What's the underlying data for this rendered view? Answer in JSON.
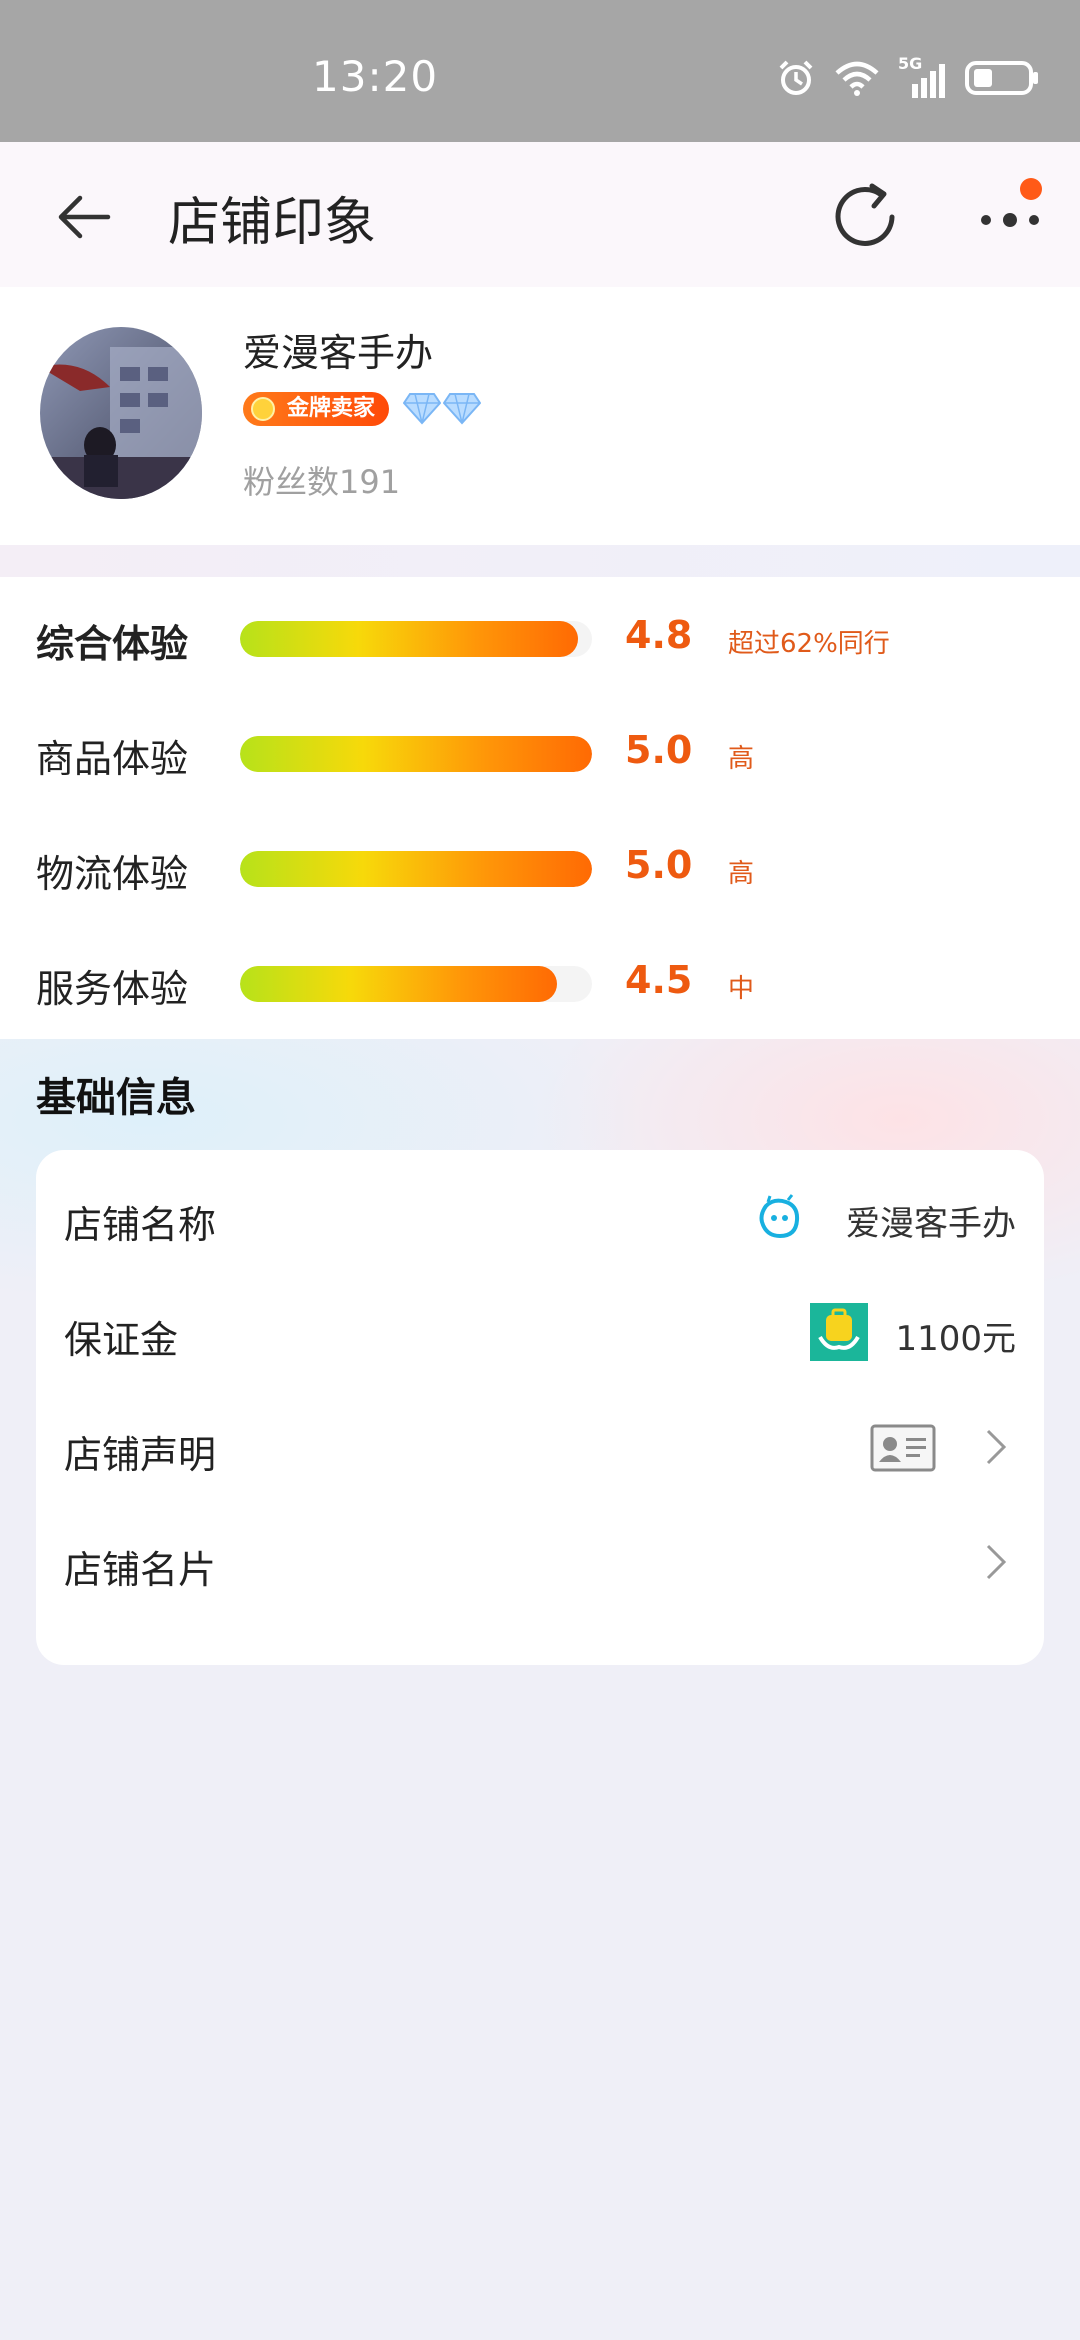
{
  "status_bar": {
    "time": "13:20",
    "network": "5G",
    "icons": [
      "alarm-icon",
      "wifi-icon",
      "signal-icon",
      "battery-icon"
    ]
  },
  "nav": {
    "title": "店铺印象",
    "icons": [
      "back-arrow-icon",
      "refresh-icon",
      "more-icon"
    ],
    "notification_dot_color": "#ff5a17"
  },
  "shop": {
    "name": "爱漫客手办",
    "badge": "金牌卖家",
    "diamond_count": 2,
    "fans": "粉丝数191"
  },
  "ratings": [
    {
      "label": "综合体验",
      "score": "4.8",
      "level": 0.96,
      "note": "超过62%同行",
      "bold": true
    },
    {
      "label": "商品体验",
      "score": "5.0",
      "level": 1.0,
      "note": "高",
      "bold": false
    },
    {
      "label": "物流体验",
      "score": "5.0",
      "level": 1.0,
      "note": "高",
      "bold": false
    },
    {
      "label": "服务体验",
      "score": "4.5",
      "level": 0.9,
      "note": "中",
      "bold": false
    }
  ],
  "basic_info": {
    "title": "基础信息",
    "rows": [
      {
        "label": "店铺名称",
        "value": "爱漫客手办",
        "icon": "shop-mascot-icon"
      },
      {
        "label": "保证金",
        "value": "1100元",
        "icon": "deposit-icon"
      },
      {
        "label": "店铺声明",
        "value": "",
        "icon": "id-card-icon"
      },
      {
        "label": "店铺名片",
        "value": "",
        "icon": ""
      }
    ]
  },
  "colors": {
    "accent": "#ee5a10",
    "bar_gradient": [
      "#b7e21a",
      "#f7d90a",
      "#ff9608",
      "#ff6a04"
    ]
  }
}
